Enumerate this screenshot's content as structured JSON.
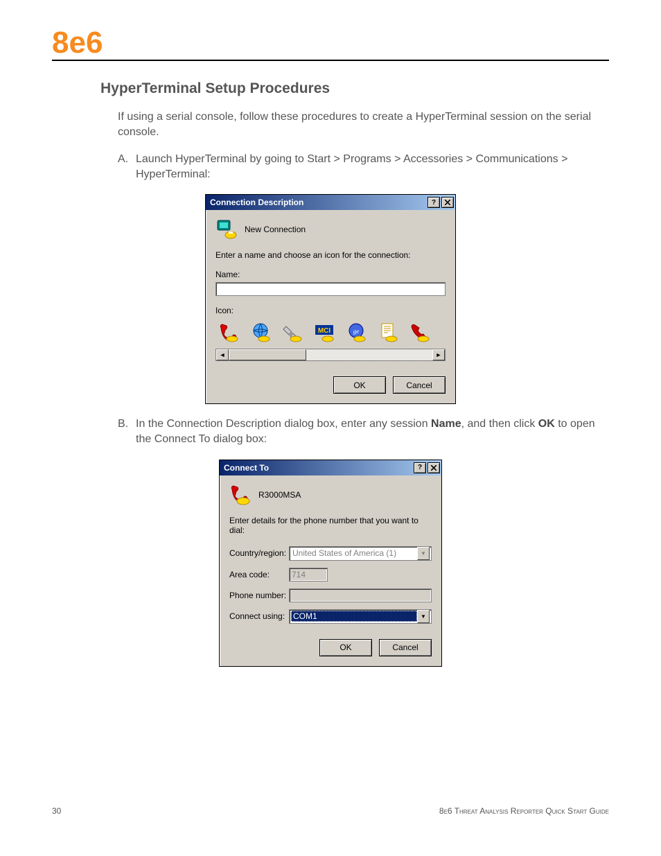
{
  "header": {
    "logo": "8e6"
  },
  "section": {
    "title": "HyperTerminal Setup Procedures",
    "intro": "If using a serial console, follow these procedures to create a HyperTerminal session on the serial console.",
    "stepA": {
      "letter": "A.",
      "text": "Launch HyperTerminal by going to Start > Programs > Accessories > Communications > HyperTerminal:"
    },
    "stepB": {
      "letter": "B.",
      "prefix": "In the Connection Description dialog box, enter any session ",
      "bold1": "Name",
      "mid": ", and then click ",
      "bold2": "OK",
      "suffix": " to open the Connect To dialog box:"
    }
  },
  "dialog1": {
    "title": "Connection Description",
    "new_connection": "New Connection",
    "instruction": "Enter a name and choose an icon for the connection:",
    "name_label": "Name:",
    "name_value": "",
    "icon_label": "Icon:",
    "ok": "OK",
    "cancel": "Cancel"
  },
  "dialog2": {
    "title": "Connect To",
    "session_name": "R3000MSA",
    "instruction": "Enter details for the phone number that you want to dial:",
    "country_label": "Country/region:",
    "country_value": "United States of America (1)",
    "area_label": "Area code:",
    "area_value": "714",
    "phone_label": "Phone number:",
    "phone_value": "",
    "connect_label": "Connect using:",
    "connect_value": "COM1",
    "ok": "OK",
    "cancel": "Cancel"
  },
  "footer": {
    "page": "30",
    "title": "8e6 Threat Analysis Reporter Quick Start Guide"
  }
}
